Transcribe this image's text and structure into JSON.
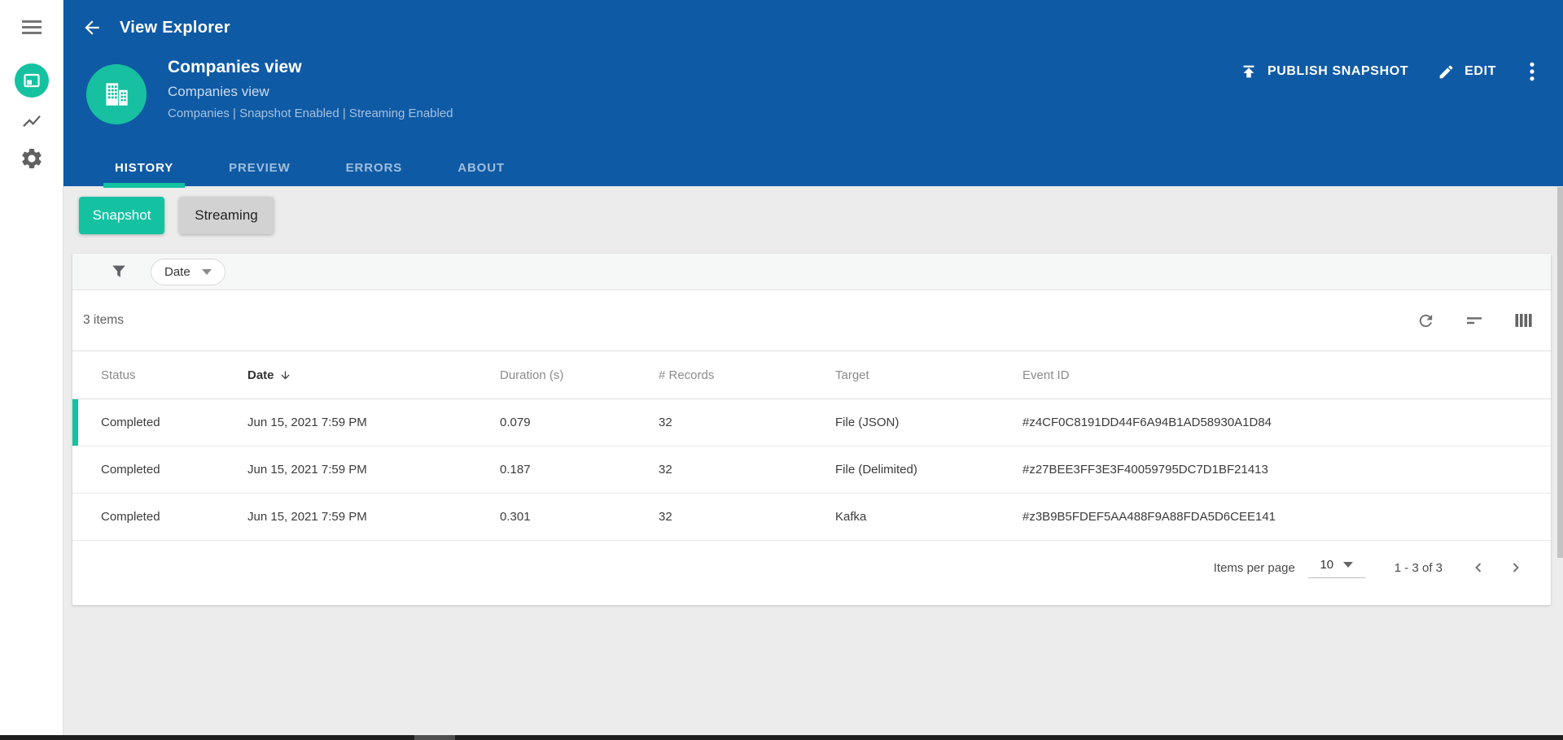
{
  "app": {
    "title": "View Explorer"
  },
  "colors": {
    "primary_blue": "#0f5aa5",
    "accent_teal": "#14c2a2",
    "page_background": "#ececec",
    "card_background": "#ffffff"
  },
  "icons": {
    "menu": "hamburger-lines",
    "workspace": "page-outline-in-teal-circle",
    "charts": "line-chart-zigzag",
    "settings": "gear",
    "back": "arrow-left",
    "publish": "upload-arrow-with-bar",
    "edit": "pencil",
    "more": "kebab-vertical-dots",
    "filter": "funnel",
    "refresh": "circular-arrow",
    "sort": "horizontal-lines",
    "columns": "vertical-bars",
    "sort_direction": "arrow-down",
    "page_prev": "chevron-left",
    "page_next": "chevron-right"
  },
  "header": {
    "title": "View Explorer",
    "entity": {
      "name": "Companies view",
      "subtitle": "Companies view",
      "meta": "Companies | Snapshot Enabled | Streaming Enabled"
    },
    "actions": {
      "publish_label": "PUBLISH SNAPSHOT",
      "edit_label": "EDIT"
    },
    "tabs": [
      {
        "label": "HISTORY",
        "active": true
      },
      {
        "label": "PREVIEW",
        "active": false
      },
      {
        "label": "ERRORS",
        "active": false
      },
      {
        "label": "ABOUT",
        "active": false
      }
    ]
  },
  "mode_buttons": {
    "snapshot": "Snapshot",
    "streaming": "Streaming"
  },
  "filter_bar": {
    "date_filter_label": "Date"
  },
  "toolbar": {
    "items_count": "3 items"
  },
  "table": {
    "columns": [
      "Status",
      "Date",
      "Duration (s)",
      "# Records",
      "Target",
      "Event ID"
    ],
    "sorted_column": "Date",
    "sort_direction": "desc",
    "rows": [
      {
        "status": "Completed",
        "date": "Jun 15, 2021 7:59 PM",
        "duration": "0.079",
        "records": "32",
        "target": "File (JSON)",
        "event_id": "#z4CF0C8191DD44F6A94B1AD58930A1D84"
      },
      {
        "status": "Completed",
        "date": "Jun 15, 2021 7:59 PM",
        "duration": "0.187",
        "records": "32",
        "target": "File (Delimited)",
        "event_id": "#z27BEE3FF3E3F40059795DC7D1BF21413"
      },
      {
        "status": "Completed",
        "date": "Jun 15, 2021 7:59 PM",
        "duration": "0.301",
        "records": "32",
        "target": "Kafka",
        "event_id": "#z3B9B5FDEF5AA488F9A88FDA5D6CEE141"
      }
    ]
  },
  "pagination": {
    "items_per_page_label": "Items per page",
    "page_size": "10",
    "range": "1 - 3 of 3"
  }
}
